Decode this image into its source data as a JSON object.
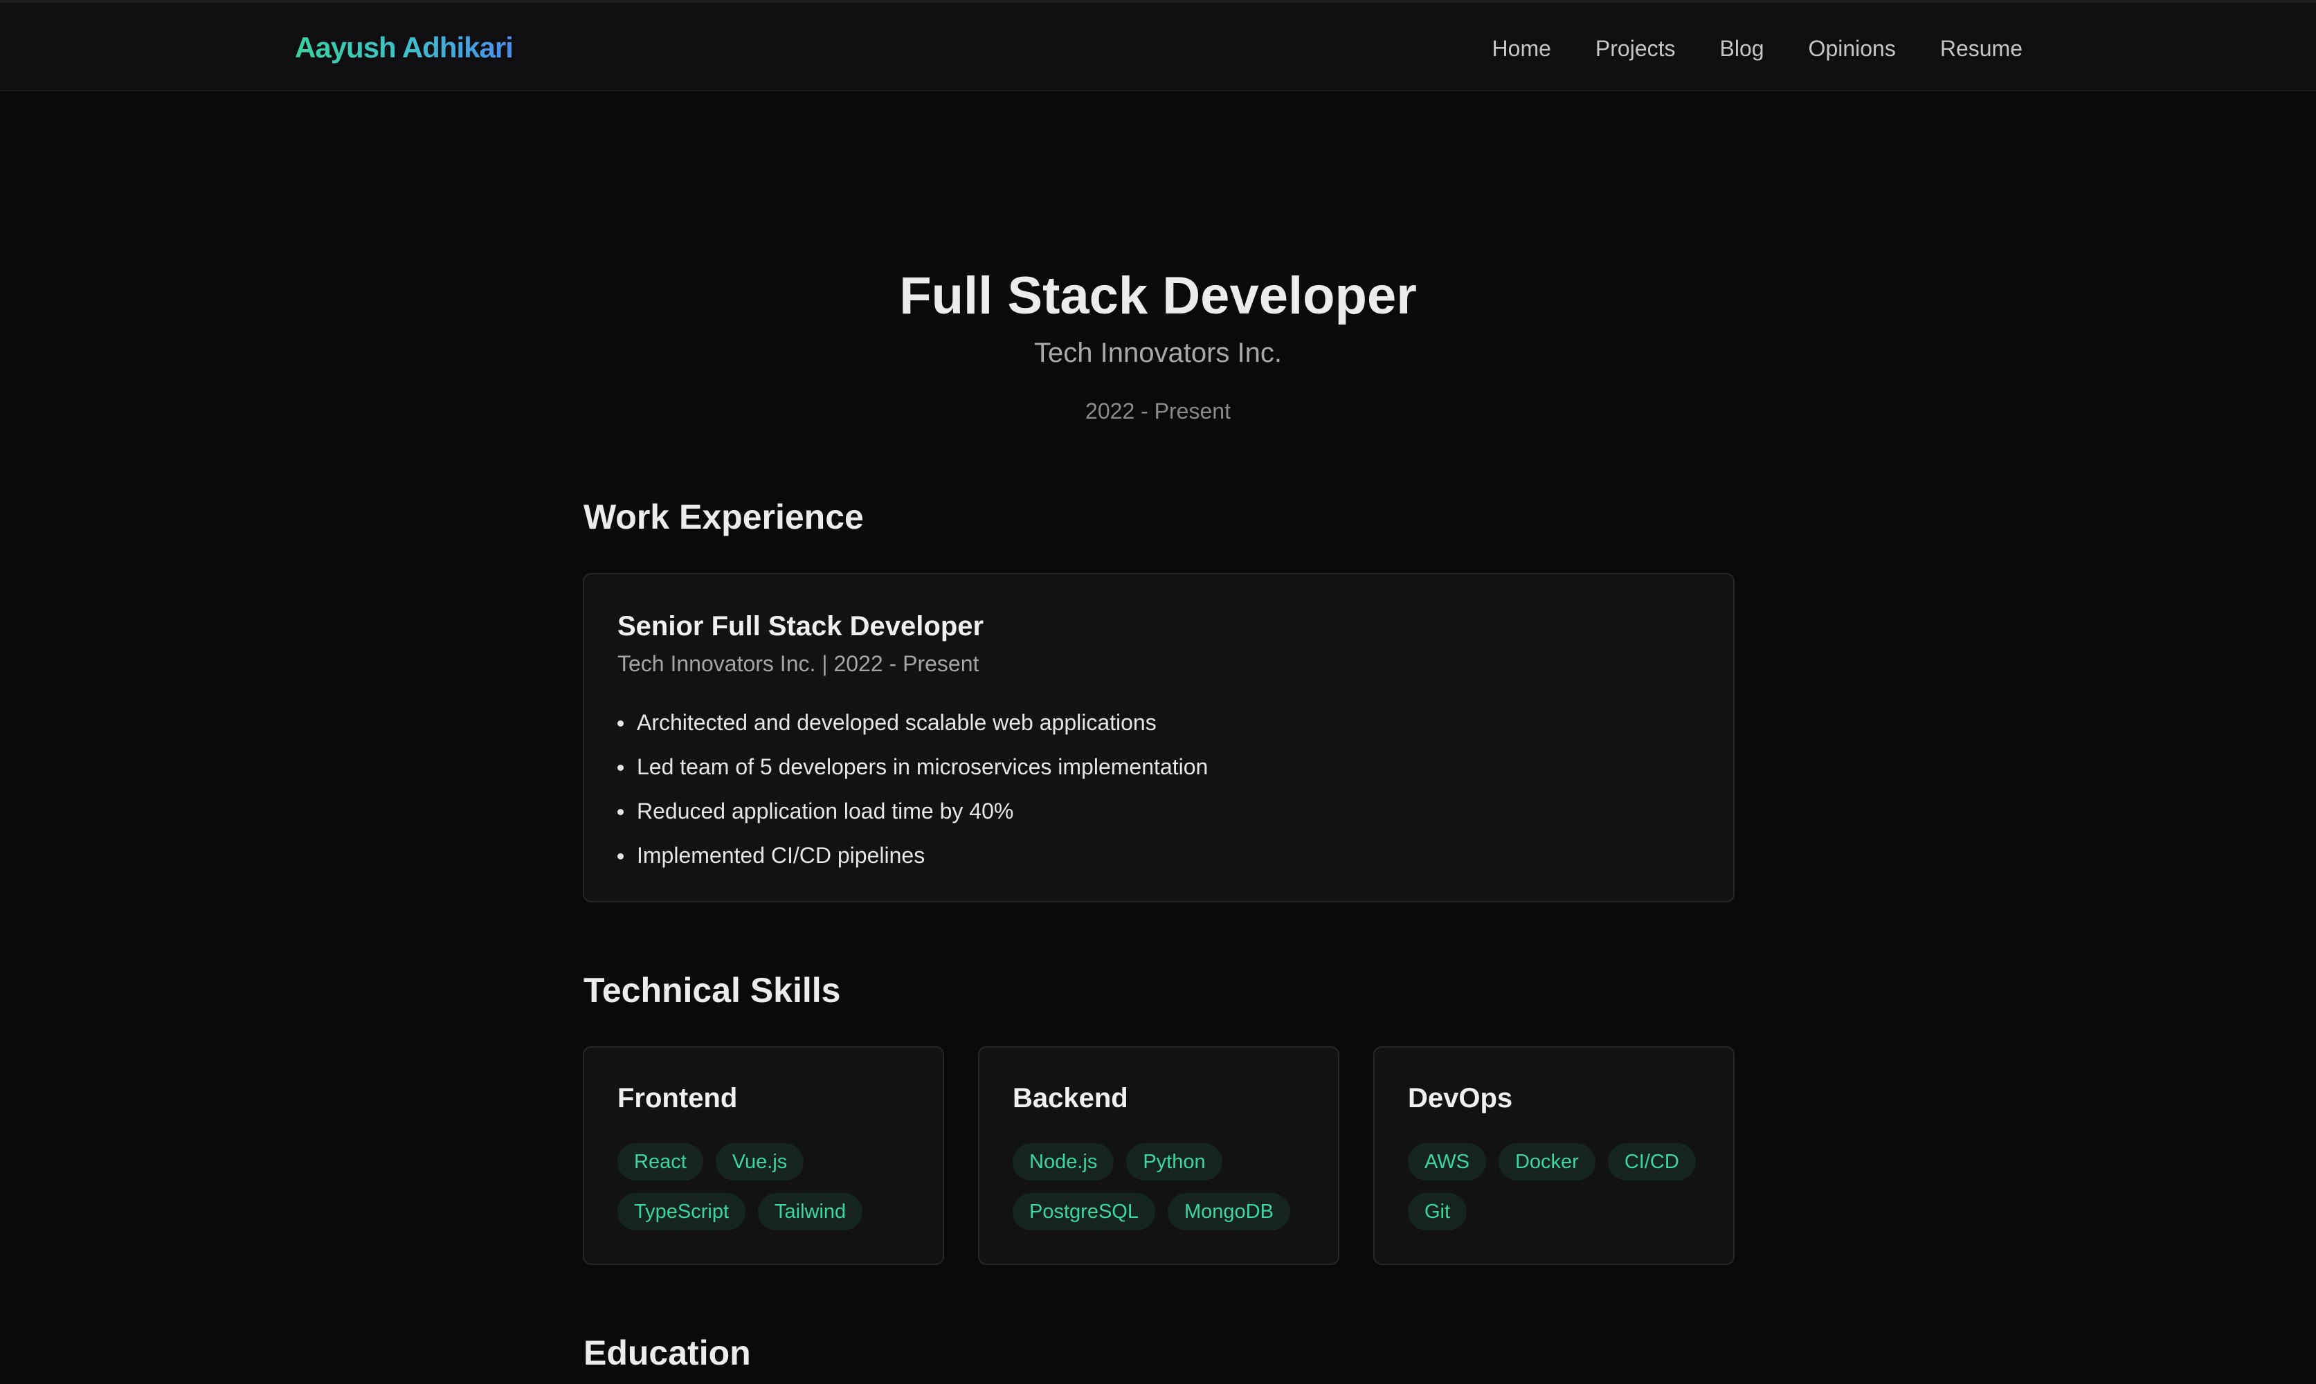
{
  "header": {
    "logo": "Aayush Adhikari",
    "nav": [
      "Home",
      "Projects",
      "Blog",
      "Opinions",
      "Resume"
    ]
  },
  "hero": {
    "title": "Full Stack Developer",
    "company": "Tech Innovators Inc.",
    "dates": "2022 - Present"
  },
  "work": {
    "heading": "Work Experience",
    "items": [
      {
        "title": "Senior Full Stack Developer",
        "subtitle": "Tech Innovators Inc. | 2022 - Present",
        "bullets": [
          "Architected and developed scalable web applications",
          "Led team of 5 developers in microservices implementation",
          "Reduced application load time by 40%",
          "Implemented CI/CD pipelines"
        ]
      }
    ]
  },
  "skills": {
    "heading": "Technical Skills",
    "groups": [
      {
        "title": "Frontend",
        "rows": [
          [
            "React",
            "Vue.js"
          ],
          [
            "TypeScript",
            "Tailwind"
          ]
        ]
      },
      {
        "title": "Backend",
        "rows": [
          [
            "Node.js",
            "Python"
          ],
          [
            "PostgreSQL",
            "MongoDB"
          ]
        ]
      },
      {
        "title": "DevOps",
        "rows": [
          [
            "AWS",
            "Docker",
            "CI/CD"
          ],
          [
            "Git"
          ]
        ]
      }
    ]
  },
  "education": {
    "heading": "Education"
  },
  "colors": {
    "background": "#0a0a0c",
    "accent_green": "#3ed6a0",
    "accent_blue": "#4a8ff0",
    "chip_bg": "#15241e"
  }
}
